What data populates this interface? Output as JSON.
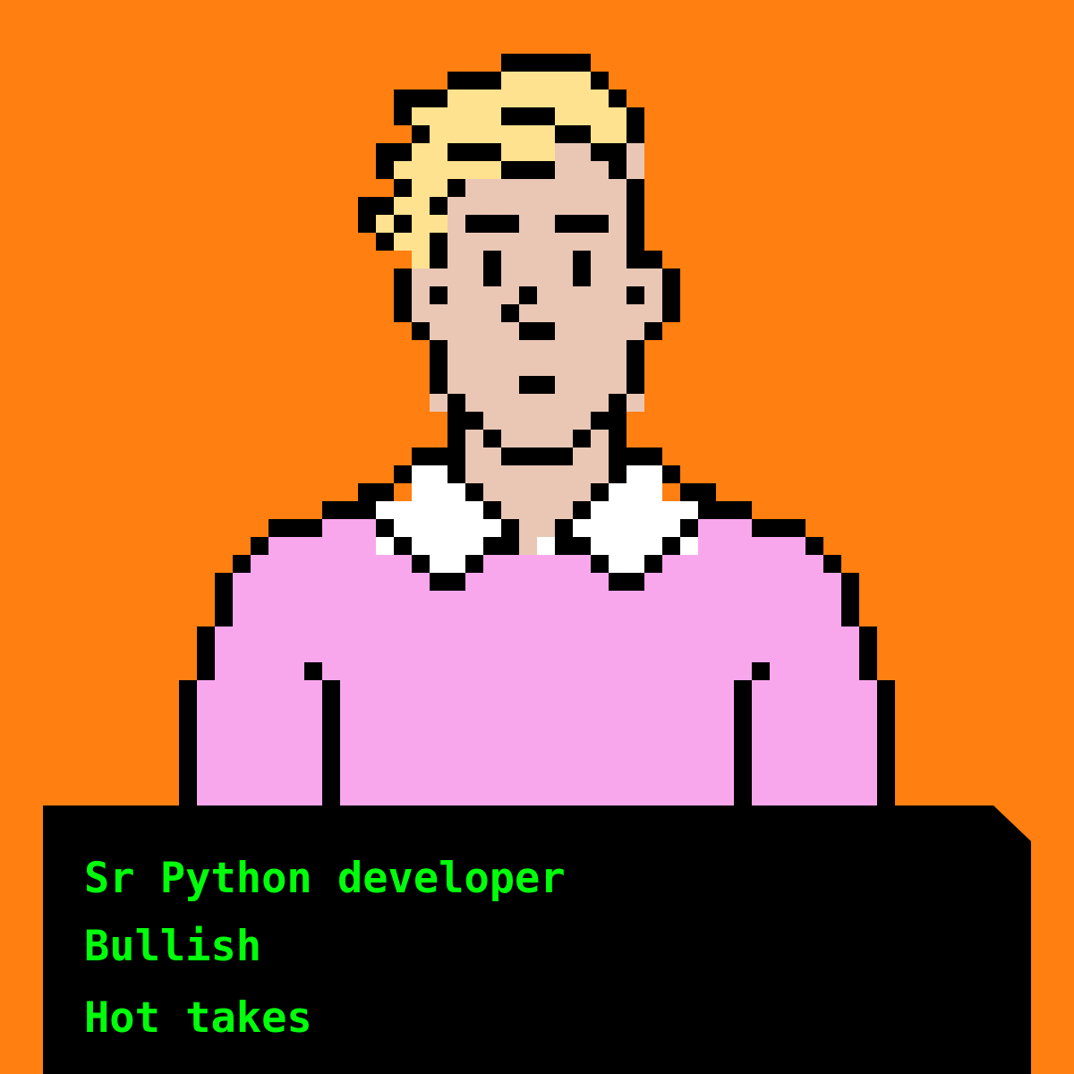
{
  "colors": {
    "background": "#FF7F11",
    "outline": "#000000",
    "hair": "#FFE28F",
    "skin": "#EAC7B5",
    "shirt": "#F9A7EC",
    "collar": "#FFFFFF",
    "text": "#00FF0A"
  },
  "traits": [
    "Sr Python developer",
    "Bullish",
    "Hot takes"
  ]
}
